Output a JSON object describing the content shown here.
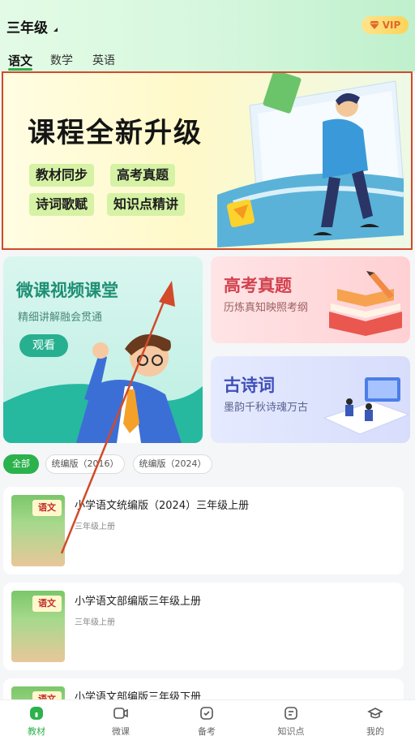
{
  "header": {
    "grade": "三年级",
    "vip_label": "VIP",
    "subjects": [
      "语文",
      "数学",
      "英语"
    ]
  },
  "banner": {
    "title": "课程全新升级",
    "tags": [
      "教材同步",
      "高考真题",
      "诗词歌赋",
      "知识点精讲"
    ]
  },
  "cards": {
    "weike": {
      "title": "微课视频课堂",
      "subtitle": "精细讲解融会贯通",
      "button": "观看"
    },
    "gaokao": {
      "title": "高考真题",
      "subtitle": "历炼真知映照考纲"
    },
    "gushi": {
      "title": "古诗词",
      "subtitle": "墨韵千秋诗魂万古"
    }
  },
  "filters": [
    "全部",
    "统编版（2016）",
    "统编版（2024）"
  ],
  "books": [
    {
      "title": "小学语文统编版（2024）三年级上册",
      "subtitle": "三年级上册",
      "cover_text": "语文"
    },
    {
      "title": "小学语文部编版三年级上册",
      "subtitle": "三年级上册",
      "cover_text": "语文"
    },
    {
      "title": "小学语文部编版三年级下册",
      "subtitle": "",
      "cover_text": "语文"
    }
  ],
  "tabbar": [
    {
      "label": "教材",
      "icon": "home-icon"
    },
    {
      "label": "微课",
      "icon": "video-icon"
    },
    {
      "label": "备考",
      "icon": "exam-icon"
    },
    {
      "label": "知识点",
      "icon": "note-icon"
    },
    {
      "label": "我的",
      "icon": "profile-icon"
    }
  ],
  "colors": {
    "accent": "#2bb24c",
    "annotation": "#d24a2a"
  }
}
